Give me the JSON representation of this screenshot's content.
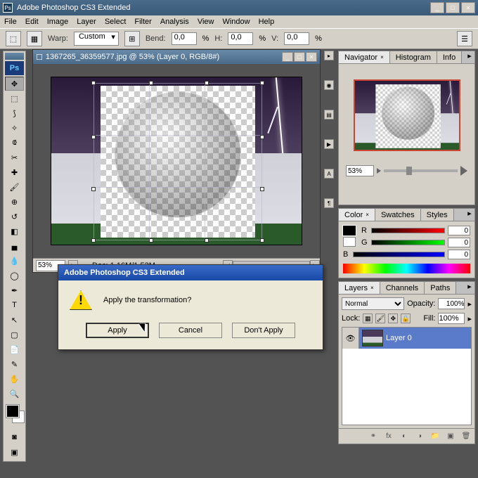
{
  "app": {
    "title": "Adobe Photoshop CS3 Extended"
  },
  "menu": {
    "items": [
      "File",
      "Edit",
      "Image",
      "Layer",
      "Select",
      "Filter",
      "Analysis",
      "View",
      "Window",
      "Help"
    ]
  },
  "options": {
    "warp_label": "Warp:",
    "warp_value": "Custom",
    "bend_label": "Bend:",
    "bend_value": "0,0",
    "h_label": "H:",
    "h_value": "0,0",
    "v_label": "V:",
    "v_value": "0,0",
    "pct": "%"
  },
  "document": {
    "title": "1367265_36359577.jpg @ 53% (Layer 0, RGB/8#)",
    "zoom": "53%",
    "doc_size": "Doc: 1,16M/1,53M"
  },
  "dialog": {
    "title": "Adobe Photoshop CS3 Extended",
    "message": "Apply the transformation?",
    "apply": "Apply",
    "cancel": "Cancel",
    "dont_apply": "Don't Apply"
  },
  "navigator": {
    "tabs": [
      "Navigator",
      "Histogram",
      "Info"
    ],
    "zoom": "53%"
  },
  "color": {
    "tabs": [
      "Color",
      "Swatches",
      "Styles"
    ],
    "channels": [
      {
        "label": "R",
        "value": "0"
      },
      {
        "label": "G",
        "value": "0"
      },
      {
        "label": "B",
        "value": "0"
      }
    ]
  },
  "layers": {
    "tabs": [
      "Layers",
      "Channels",
      "Paths"
    ],
    "blend": "Normal",
    "opacity_label": "Opacity:",
    "opacity": "100%",
    "lock_label": "Lock:",
    "fill_label": "Fill:",
    "fill": "100%",
    "items": [
      {
        "name": "Layer 0"
      }
    ]
  },
  "tools": [
    "move",
    "marquee",
    "lasso",
    "wand",
    "crop",
    "slice",
    "heal",
    "brush",
    "stamp",
    "history",
    "eraser",
    "gradient",
    "blur",
    "dodge",
    "pen",
    "type",
    "path",
    "shape",
    "notes",
    "eyedrop",
    "hand",
    "zoom"
  ]
}
